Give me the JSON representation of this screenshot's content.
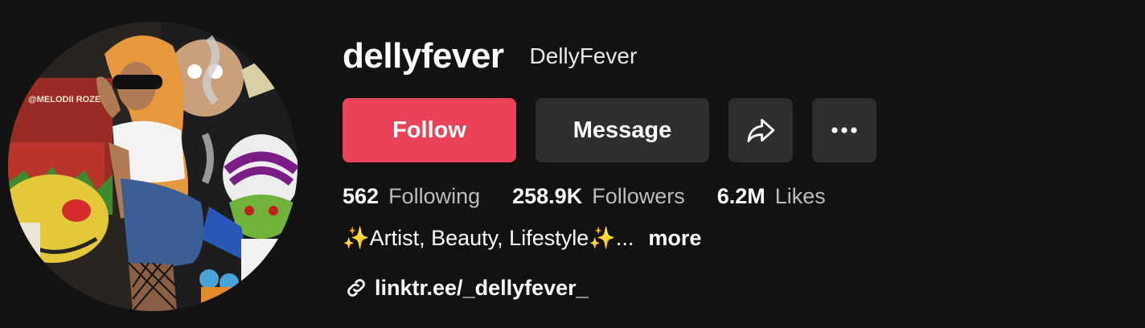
{
  "profile": {
    "username": "dellyfever",
    "display_name": "DellyFever",
    "avatar_alt": "profile photo",
    "avatar_wall_text": "@MELODII ROZE"
  },
  "actions": {
    "follow_label": "Follow",
    "message_label": "Message",
    "share_icon": "share-arrow-icon",
    "more_icon": "ellipsis-icon"
  },
  "stats": {
    "following": {
      "value": "562",
      "label": "Following"
    },
    "followers": {
      "value": "258.9K",
      "label": "Followers"
    },
    "likes": {
      "value": "6.2M",
      "label": "Likes"
    }
  },
  "bio": {
    "text": "✨Artist, Beauty, Lifestyle✨...",
    "more_label": "more"
  },
  "link": {
    "text": "linktr.ee/_dellyfever_",
    "icon": "link-icon"
  },
  "colors": {
    "background": "#121212",
    "follow": "#ea4359",
    "secondary_button": "#2e2e2e",
    "muted_text": "#bdbdbd"
  }
}
